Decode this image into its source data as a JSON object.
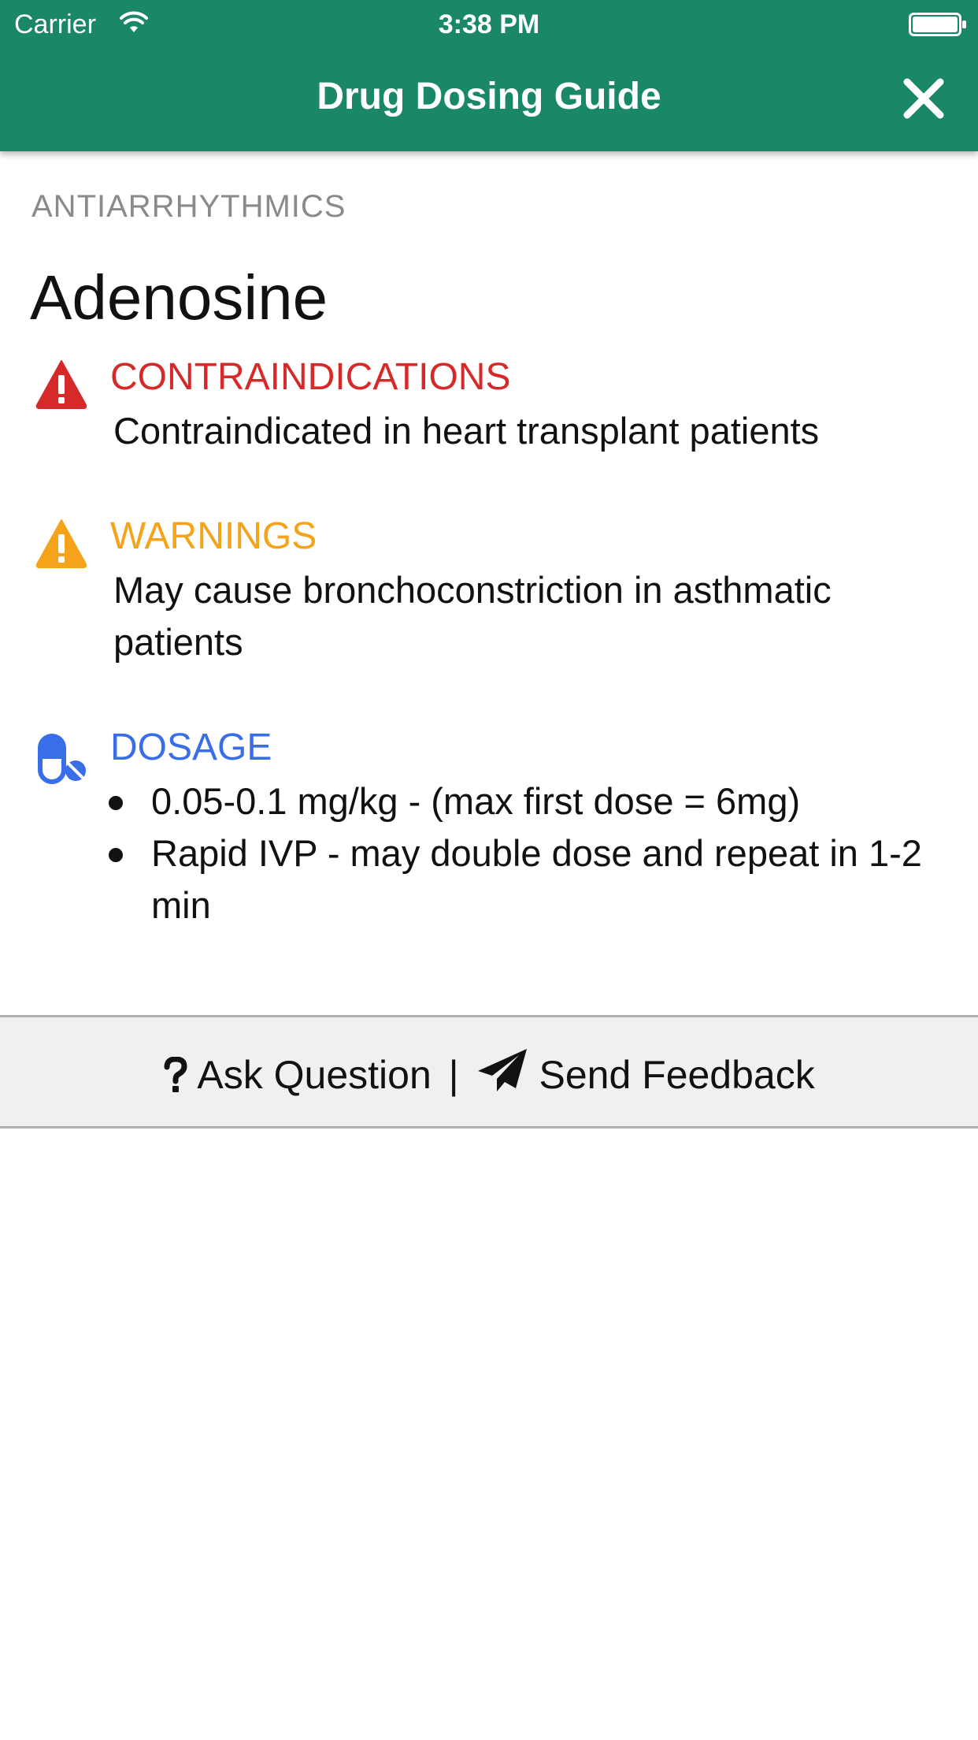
{
  "status_bar": {
    "carrier": "Carrier",
    "time": "3:38 PM"
  },
  "nav": {
    "title": "Drug Dosing Guide",
    "close_icon": "close-icon"
  },
  "drug": {
    "category": "ANTIARRHYTHMICS",
    "name": "Adenosine"
  },
  "sections": {
    "contraindications": {
      "title": "CONTRAINDICATIONS",
      "icon": "alert-triangle-icon",
      "color": "#d62a2a",
      "body": "Contraindicated in heart transplant patients"
    },
    "warnings": {
      "title": "WARNINGS",
      "icon": "warning-triangle-icon",
      "color": "#f5a31a",
      "body": "May cause bronchoconstriction in asthmatic patients"
    },
    "dosage": {
      "title": "DOSAGE",
      "icon": "pills-icon",
      "color": "#3a6ee8",
      "items": [
        "0.05-0.1 mg/kg - (max first dose = 6mg)",
        "Rapid IVP - may double dose and repeat in 1-2 min"
      ]
    }
  },
  "footer": {
    "ask_label": "Ask Question",
    "separator": "|",
    "feedback_label": "Send Feedback",
    "ask_icon": "question-mark-icon",
    "feedback_icon": "paper-plane-icon"
  },
  "colors": {
    "header": "#1a8768",
    "footer_bg": "#f0f0f0"
  }
}
